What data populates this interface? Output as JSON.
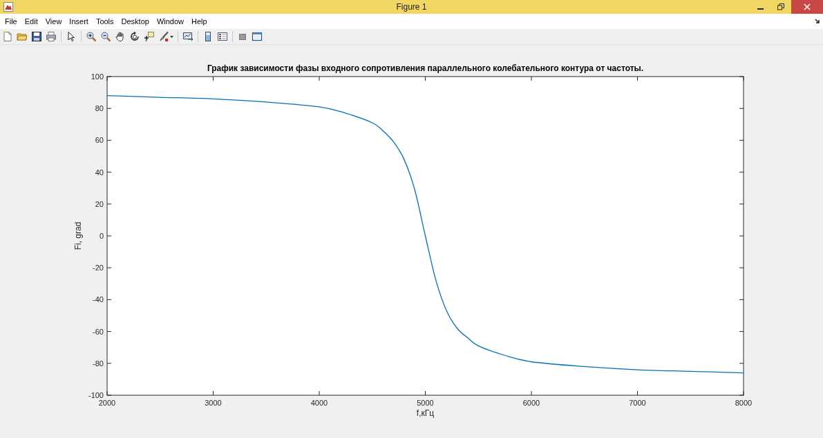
{
  "window": {
    "title": "Figure 1"
  },
  "menu": [
    "File",
    "Edit",
    "View",
    "Insert",
    "Tools",
    "Desktop",
    "Window",
    "Help"
  ],
  "chart_data": {
    "type": "line",
    "title": "График зависимости фазы входного сопротивления параллельного колебательного контура от частоты.",
    "xlabel": "f,кГц",
    "ylabel": "Fi, grad",
    "x": [
      2000,
      2500,
      3000,
      3500,
      4000,
      4250,
      4500,
      4600,
      4700,
      4800,
      4900,
      5000,
      5100,
      5200,
      5300,
      5400,
      5500,
      5750,
      6000,
      6500,
      7000,
      7500,
      8000
    ],
    "series": [
      {
        "color": "#0072bd",
        "values": [
          88,
          87,
          86,
          84,
          81,
          77,
          71,
          66,
          59,
          48,
          29,
          0,
          -28,
          -47,
          -58,
          -64,
          -69,
          -75,
          -79,
          -82,
          -84,
          -85,
          -86
        ]
      }
    ],
    "xlim": [
      2000,
      8000
    ],
    "ylim": [
      -100,
      100
    ],
    "xticks": [
      2000,
      3000,
      4000,
      5000,
      6000,
      7000,
      8000
    ],
    "yticks": [
      -100,
      -80,
      -60,
      -40,
      -20,
      0,
      20,
      40,
      60,
      80,
      100
    ]
  }
}
